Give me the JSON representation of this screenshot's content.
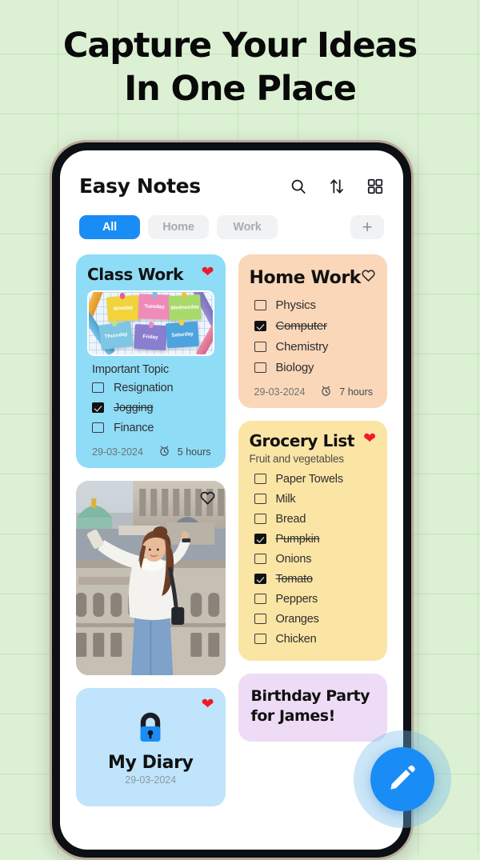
{
  "headline": {
    "line1": "Capture Your Ideas",
    "line2": "In One Place"
  },
  "colors": {
    "background": "#dcf0d4",
    "accent_blue": "#1a8cf5",
    "heart_red": "#f01a29",
    "class_work_card": "#8fdcf7",
    "home_work_card": "#fad7b9",
    "grocery_card": "#fbe5a5",
    "diary_card": "#bfe4fb",
    "birthday_card": "#eedcf6",
    "phone_frame": "#b8a99a",
    "phone_bezel": "#0c0f14"
  },
  "app": {
    "title": "Easy Notes",
    "icons": [
      {
        "name": "search-icon",
        "label": "Search"
      },
      {
        "name": "sort-icon",
        "label": "Sort"
      },
      {
        "name": "grid-view-icon",
        "label": "Grid view"
      }
    ],
    "tabs": [
      {
        "label": "All",
        "active": true
      },
      {
        "label": "Home",
        "active": false
      },
      {
        "label": "Work",
        "active": false
      }
    ],
    "add_tab_label": "+",
    "fab": {
      "name": "edit-pencil-fab",
      "label": "New note"
    }
  },
  "cards": {
    "class_work": {
      "title": "Class Work",
      "favorite": true,
      "section_label": "Important Topic",
      "items": [
        {
          "text": "Resignation",
          "done": false
        },
        {
          "text": "Jogging",
          "done": true
        },
        {
          "text": "Finance",
          "done": false
        }
      ],
      "date": "29-03-2024",
      "duration": "5 hours",
      "image_stickies": [
        {
          "label": "Monday",
          "color": "#f2d33c"
        },
        {
          "label": "Tuesday",
          "color": "#ef8bb9"
        },
        {
          "label": "Wednesday",
          "color": "#a8d96b"
        },
        {
          "label": "Thursday",
          "color": "#7ec6e3"
        },
        {
          "label": "Friday",
          "color": "#8a7ece"
        },
        {
          "label": "Saturday",
          "color": "#4da3dd"
        }
      ]
    },
    "home_work": {
      "title": "Home Work",
      "favorite": false,
      "items": [
        {
          "text": "Physics",
          "done": false
        },
        {
          "text": "Computer",
          "done": true
        },
        {
          "text": "Chemistry",
          "done": false
        },
        {
          "text": "Biology",
          "done": false
        }
      ],
      "date": "29-03-2024",
      "duration": "7 hours"
    },
    "grocery": {
      "title": "Grocery List",
      "favorite": true,
      "subtitle": "Fruit and vegetables",
      "items": [
        {
          "text": "Paper Towels",
          "done": false
        },
        {
          "text": "Milk",
          "done": false
        },
        {
          "text": "Bread",
          "done": false
        },
        {
          "text": "Pumpkin",
          "done": true
        },
        {
          "text": "Onions",
          "done": false
        },
        {
          "text": "Tomato",
          "done": true
        },
        {
          "text": "Peppers",
          "done": false
        },
        {
          "text": "Oranges",
          "done": false
        },
        {
          "text": "Chicken",
          "done": false
        }
      ]
    },
    "photo": {
      "favorite": false,
      "alt": "Woman taking a selfie on a rooftop in Paris"
    },
    "diary": {
      "title": "My Diary",
      "favorite": true,
      "date": "29-03-2024",
      "icon": "lock-icon"
    },
    "birthday": {
      "line1": "Birthday Party",
      "line2": "for James!"
    }
  }
}
